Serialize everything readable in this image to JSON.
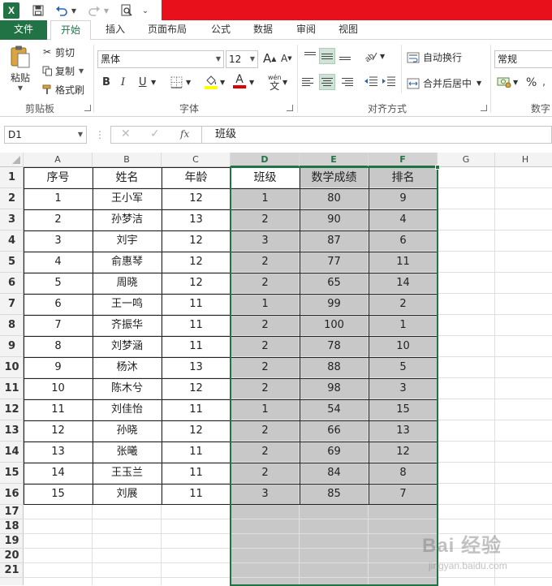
{
  "qat": {
    "app_icon": "X"
  },
  "tabs": [
    "文件",
    "开始",
    "插入",
    "页面布局",
    "公式",
    "数据",
    "审阅",
    "视图"
  ],
  "ribbon": {
    "clipboard": {
      "label": "剪贴板",
      "paste": "粘贴",
      "cut": "剪切",
      "copy": "复制",
      "format_painter": "格式刷"
    },
    "font": {
      "label": "字体",
      "name": "黑体",
      "size": "12",
      "grow": "A",
      "shrink": "A",
      "bold": "B",
      "italic": "I",
      "underline": "U",
      "phonetic_top": "wén",
      "phonetic_bottom": "文"
    },
    "align": {
      "label": "对齐方式",
      "wrap": "自动换行",
      "merge": "合并后居中"
    },
    "number": {
      "label": "数字",
      "format": "常规",
      "percent": "%"
    }
  },
  "formula_bar": {
    "name_box": "D1",
    "fx": "fx",
    "content": "班级"
  },
  "columns": [
    "A",
    "B",
    "C",
    "D",
    "E",
    "F",
    "G",
    "H"
  ],
  "rows": [
    "1",
    "2",
    "3",
    "4",
    "5",
    "6",
    "7",
    "8",
    "9",
    "10",
    "11",
    "12",
    "13",
    "14",
    "15",
    "16",
    "17",
    "18",
    "19",
    "20",
    "21"
  ],
  "table": {
    "headers": [
      "序号",
      "姓名",
      "年龄",
      "班级",
      "数学成绩",
      "排名"
    ],
    "rows": [
      [
        "1",
        "王小军",
        "12",
        "1",
        "80",
        "9"
      ],
      [
        "2",
        "孙梦洁",
        "13",
        "2",
        "90",
        "4"
      ],
      [
        "3",
        "刘宇",
        "12",
        "3",
        "87",
        "6"
      ],
      [
        "4",
        "俞惠琴",
        "12",
        "2",
        "77",
        "11"
      ],
      [
        "5",
        "周晓",
        "12",
        "2",
        "65",
        "14"
      ],
      [
        "6",
        "王一鸣",
        "11",
        "1",
        "99",
        "2"
      ],
      [
        "7",
        "齐振华",
        "11",
        "2",
        "100",
        "1"
      ],
      [
        "8",
        "刘梦涵",
        "11",
        "2",
        "78",
        "10"
      ],
      [
        "9",
        "杨沐",
        "13",
        "2",
        "88",
        "5"
      ],
      [
        "10",
        "陈木兮",
        "12",
        "2",
        "98",
        "3"
      ],
      [
        "11",
        "刘佳怡",
        "11",
        "1",
        "54",
        "15"
      ],
      [
        "12",
        "孙晓",
        "12",
        "2",
        "66",
        "13"
      ],
      [
        "13",
        "张曦",
        "11",
        "2",
        "69",
        "12"
      ],
      [
        "14",
        "王玉兰",
        "11",
        "2",
        "84",
        "8"
      ],
      [
        "15",
        "刘展",
        "11",
        "3",
        "85",
        "7"
      ]
    ]
  },
  "selection": {
    "range": "D1:F21",
    "fill": "#c8c8c8",
    "accent": "#217346"
  },
  "colors": {
    "file_tab": "#217346",
    "title_red": "#e8101a",
    "highlight": "#ffff00",
    "font_red": "#e00000"
  },
  "watermark": {
    "text": "Bai 经验",
    "sub": "jingyan.baidu.com"
  }
}
